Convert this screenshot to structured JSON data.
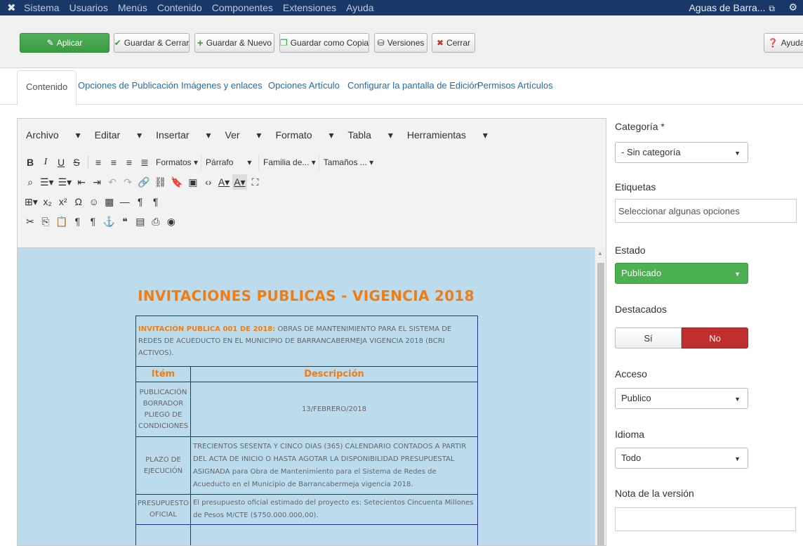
{
  "topnav": {
    "menu": [
      "Sistema",
      "Usuarios",
      "Menús",
      "Contenido",
      "Componentes",
      "Extensiones",
      "Ayuda"
    ],
    "site_name": "Aguas de Barra..."
  },
  "toolbar": {
    "apply": "Aplicar",
    "save_close": "Guardar & Cerrar",
    "save_new": "Guardar & Nuevo",
    "save_copy": "Guardar como Copia",
    "versions": "Versiones",
    "close": "Cerrar",
    "help": "Ayuda"
  },
  "tabs": [
    "Contenido",
    "Opciones de Publicación",
    "Imágenes y enlaces",
    "Opciones Artículo",
    "Configurar la pantalla de Edición",
    "Permisos Artículos"
  ],
  "editor": {
    "menubar": [
      "Archivo",
      "Editar",
      "Insertar",
      "Ver",
      "Formato",
      "Tabla",
      "Herramientas"
    ],
    "dropdowns": {
      "formats": "Formatos",
      "paragraph": "Párrafo",
      "font_family": "Familia de...",
      "font_size": "Tamaños ..."
    }
  },
  "document": {
    "title": "INVITACIONES PUBLICAS - VIGENCIA 2018",
    "intro_label": "INVITACIÓN PUBLICA 001 DE 2018:",
    "intro_text": " OBRAS DE MANTENIMIENTO PARA EL SISTEMA DE REDES DE ACUEDUCTO EN EL MUNICIPIO DE BARRANCABERMEJA VIGENCIA 2018 (BCRI ACTIVOS).",
    "col_item": "Itém",
    "col_desc": "Descripción",
    "rows": [
      {
        "item": "PUBLICACIÓN BORRADOR PLIEGO DE CONDICIONES",
        "desc": "13/FEBRERO/2018"
      },
      {
        "item": "PLAZO DE EJECUCIÓN",
        "desc": "TRECIENTOS SESENTA Y CINCO DIAS (365) CALENDARIO CONTADOS A PARTIR DEL ACTA DE INICIO O HASTA AGOTAR LA DISPONIBILIDAD PRESUPUESTAL ASIGNADA para Obra de Mantenimiento para el Sistema de Redes de Acueducto en el Municipio de Barrancabermeja vigencia 2018."
      },
      {
        "item": "PRESUPUESTO OFICIAL",
        "desc": "El presupuesto oficial estimado del proyecto es: Setecientos Cincuenta Millones de Pesos M/CTE ($750.000.000,00)."
      }
    ]
  },
  "sidebar": {
    "category_label": "Categoría *",
    "category_value": "- Sin categoría",
    "tags_label": "Etiquetas",
    "tags_placeholder": "Seleccionar algunas opciones",
    "status_label": "Estado",
    "status_value": "Publicado",
    "featured_label": "Destacados",
    "featured_yes": "Sí",
    "featured_no": "No",
    "access_label": "Acceso",
    "access_value": "Publico",
    "language_label": "Idioma",
    "language_value": "Todo",
    "version_note_label": "Nota de la versión"
  },
  "colors": {
    "nav": "#1a3867",
    "apply": "#46a64e",
    "status": "#4caf50",
    "no": "#bf2f2f",
    "doc_bg": "#bcdbec",
    "doc_accent": "#f07c12"
  }
}
